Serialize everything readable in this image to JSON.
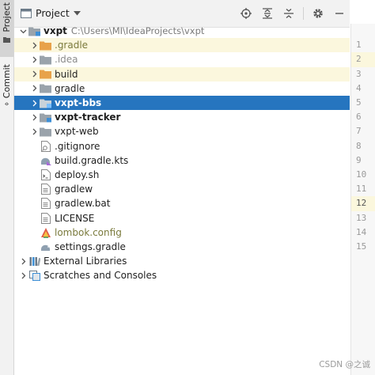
{
  "left_strip": {
    "tabs": [
      {
        "label": "Project",
        "icon": "folder-icon",
        "active": true
      },
      {
        "label": "Commit",
        "icon": "commit-icon",
        "active": false
      }
    ]
  },
  "header": {
    "title": "Project",
    "actions": [
      "locate-icon",
      "expand-all-icon",
      "collapse-all-icon",
      "gear-icon",
      "minimize-icon"
    ]
  },
  "tree": {
    "root": {
      "name": "vxpt",
      "path": "C:\\Users\\MI\\IdeaProjects\\vxpt"
    },
    "items": [
      {
        "name": ".gradle",
        "icon": "orange-folder-icon",
        "excluded": true
      },
      {
        "name": ".idea",
        "icon": "gray-folder-icon",
        "excluded": false
      },
      {
        "name": "build",
        "icon": "orange-folder-icon",
        "excluded": true
      },
      {
        "name": "gradle",
        "icon": "gray-folder-icon",
        "excluded": false
      },
      {
        "name": "vxpt-bbs",
        "icon": "module-folder-icon",
        "selected": true
      },
      {
        "name": "vxpt-tracker",
        "icon": "module-folder-icon"
      },
      {
        "name": "vxpt-web",
        "icon": "gray-folder-icon"
      },
      {
        "name": ".gitignore",
        "icon": "gitignore-file-icon"
      },
      {
        "name": "build.gradle.kts",
        "icon": "gradle-kts-file-icon"
      },
      {
        "name": "deploy.sh",
        "icon": "shell-file-icon"
      },
      {
        "name": "gradlew",
        "icon": "text-file-icon"
      },
      {
        "name": "gradlew.bat",
        "icon": "text-file-icon"
      },
      {
        "name": "LICENSE",
        "icon": "text-file-icon"
      },
      {
        "name": "lombok.config",
        "icon": "lombok-file-icon"
      },
      {
        "name": "settings.gradle",
        "icon": "gradle-file-icon"
      }
    ],
    "external_libraries": "External Libraries",
    "scratches": "Scratches and Consoles"
  },
  "gutter": {
    "lines": [
      "1",
      "2",
      "3",
      "4",
      "5",
      "6",
      "7",
      "8",
      "9",
      "10",
      "11",
      "12",
      "13",
      "14",
      "15"
    ]
  },
  "watermark": "CSDN @之诚",
  "colors": {
    "selection": "#2675bf",
    "excluded_bg": "#fbf7dd",
    "orange_folder": "#e8a24a",
    "gray_folder": "#9aa3ab"
  }
}
